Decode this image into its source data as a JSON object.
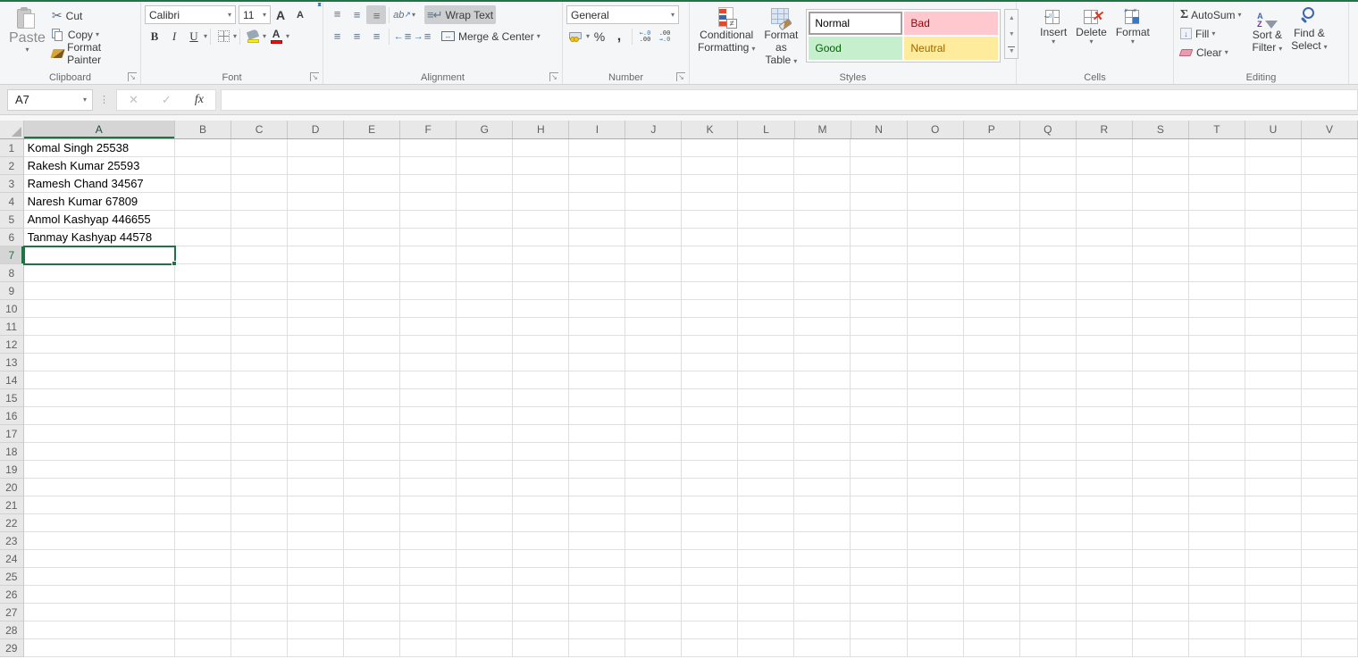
{
  "ribbon": {
    "clipboard": {
      "label": "Clipboard",
      "paste": "Paste",
      "cut": "Cut",
      "copy": "Copy",
      "format_painter": "Format Painter"
    },
    "font": {
      "label": "Font",
      "name": "Calibri",
      "size": "11",
      "bold": "B",
      "italic": "I",
      "underline": "U",
      "grow": "A",
      "shrink": "A"
    },
    "alignment": {
      "label": "Alignment",
      "wrap_text": "Wrap Text",
      "merge_center": "Merge & Center",
      "orientation": "ab"
    },
    "number": {
      "label": "Number",
      "format": "General",
      "percent": "%",
      "comma": ",",
      "inc_top": "←.0",
      "inc_bot": ".00",
      "dec_top": ".00",
      "dec_bot": "→.0",
      "neq": "≠"
    },
    "styles": {
      "label": "Styles",
      "conditional_line1": "Conditional",
      "conditional_line2": "Formatting",
      "table_line1": "Format as",
      "table_line2": "Table",
      "gallery": [
        "Normal",
        "Bad",
        "Good",
        "Neutral"
      ],
      "neq": "≠"
    },
    "cells": {
      "label": "Cells",
      "insert": "Insert",
      "delete": "Delete",
      "format": "Format"
    },
    "editing": {
      "label": "Editing",
      "autosum": "AutoSum",
      "sum_glyph": "Σ",
      "fill": "Fill",
      "clear": "Clear",
      "sort_line1": "Sort &",
      "sort_line2": "Filter",
      "find_line1": "Find &",
      "find_line2": "Select",
      "az_a": "A",
      "az_z": "Z"
    }
  },
  "formula_bar": {
    "name_box": "A7",
    "cancel_glyph": "✕",
    "enter_glyph": "✓",
    "fx_label": "fx",
    "formula": ""
  },
  "grid": {
    "columns": [
      "A",
      "B",
      "C",
      "D",
      "E",
      "F",
      "G",
      "H",
      "I",
      "J",
      "K",
      "L",
      "M",
      "N",
      "O",
      "P",
      "Q",
      "R",
      "S",
      "T",
      "U",
      "V"
    ],
    "row_count": 29,
    "selected_cell": "A7",
    "selected_column": "A",
    "selected_row": 7,
    "cells": {
      "A1": "Komal Singh 25538",
      "A2": "Rakesh Kumar 25593",
      "A3": "Ramesh Chand 34567",
      "A4": "Naresh Kumar 67809",
      "A5": "Anmol Kashyap 446655",
      "A6": "Tanmay Kashyap 44578"
    }
  },
  "colors": {
    "accent_green": "#217346",
    "style_bad_bg": "#ffc7ce",
    "style_bad_text": "#9c0006",
    "style_good_bg": "#c6efce",
    "style_good_text": "#006100",
    "style_neutral_bg": "#ffeb9c",
    "style_neutral_text": "#9c6500"
  }
}
